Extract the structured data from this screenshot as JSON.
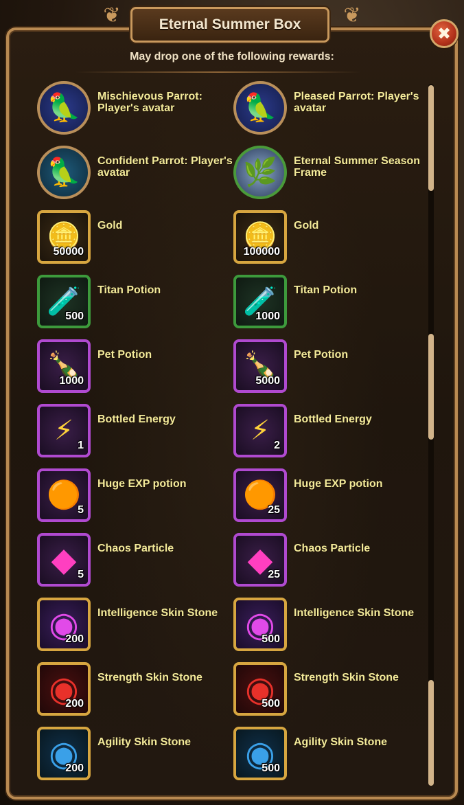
{
  "dialog": {
    "title": "Eternal Summer Box",
    "subtitle": "May drop one of the following rewards:",
    "close_symbol": "✖"
  },
  "colors": {
    "label_text": "#f3ea9a",
    "frame_gold": "#d7a640",
    "frame_green": "#3d9a3c",
    "frame_purple": "#b04ad0"
  },
  "rewards": [
    {
      "name": "Mischievous Parrot: Player's avatar",
      "qty": "",
      "icon": "red-parrot-avatar-icon",
      "glyph": "🦜"
    },
    {
      "name": "Pleased Parrot: Player's avatar",
      "qty": "",
      "icon": "pleased-parrot-avatar-icon",
      "glyph": "🦜"
    },
    {
      "name": "Confident Parrot: Player's avatar",
      "qty": "",
      "icon": "confident-parrot-avatar-icon",
      "glyph": "🦜"
    },
    {
      "name": "Eternal Summer Season Frame",
      "qty": "",
      "icon": "season-frame-icon",
      "glyph": "🌿"
    },
    {
      "name": "Gold",
      "qty": "50000",
      "icon": "gold-coin-icon",
      "glyph": "🪙"
    },
    {
      "name": "Gold",
      "qty": "100000",
      "icon": "gold-coin-icon",
      "glyph": "🪙"
    },
    {
      "name": "Titan Potion",
      "qty": "500",
      "icon": "titan-potion-icon",
      "glyph": "🧪"
    },
    {
      "name": "Titan Potion",
      "qty": "1000",
      "icon": "titan-potion-icon",
      "glyph": "🧪"
    },
    {
      "name": "Pet Potion",
      "qty": "1000",
      "icon": "pet-potion-icon",
      "glyph": "🍾"
    },
    {
      "name": "Pet Potion",
      "qty": "5000",
      "icon": "pet-potion-icon",
      "glyph": "🍾"
    },
    {
      "name": "Bottled Energy",
      "qty": "1",
      "icon": "bottled-energy-icon",
      "glyph": "⚡"
    },
    {
      "name": "Bottled Energy",
      "qty": "2",
      "icon": "bottled-energy-icon",
      "glyph": "⚡"
    },
    {
      "name": "Huge EXP potion",
      "qty": "5",
      "icon": "exp-potion-icon",
      "glyph": "🟠"
    },
    {
      "name": "Huge EXP potion",
      "qty": "25",
      "icon": "exp-potion-icon",
      "glyph": "🟠"
    },
    {
      "name": "Chaos Particle",
      "qty": "5",
      "icon": "chaos-particle-icon",
      "glyph": "◆"
    },
    {
      "name": "Chaos Particle",
      "qty": "25",
      "icon": "chaos-particle-icon",
      "glyph": "◆"
    },
    {
      "name": "Intelligence Skin Stone",
      "qty": "200",
      "icon": "intelligence-stone-icon",
      "glyph": "◉"
    },
    {
      "name": "Intelligence Skin Stone",
      "qty": "500",
      "icon": "intelligence-stone-icon",
      "glyph": "◉"
    },
    {
      "name": "Strength Skin Stone",
      "qty": "200",
      "icon": "strength-stone-icon",
      "glyph": "◉"
    },
    {
      "name": "Strength Skin Stone",
      "qty": "500",
      "icon": "strength-stone-icon",
      "glyph": "◉"
    },
    {
      "name": "Agility Skin Stone",
      "qty": "200",
      "icon": "agility-stone-icon",
      "glyph": "◉"
    },
    {
      "name": "Agility Skin Stone",
      "qty": "500",
      "icon": "agility-stone-icon",
      "glyph": "◉"
    }
  ]
}
